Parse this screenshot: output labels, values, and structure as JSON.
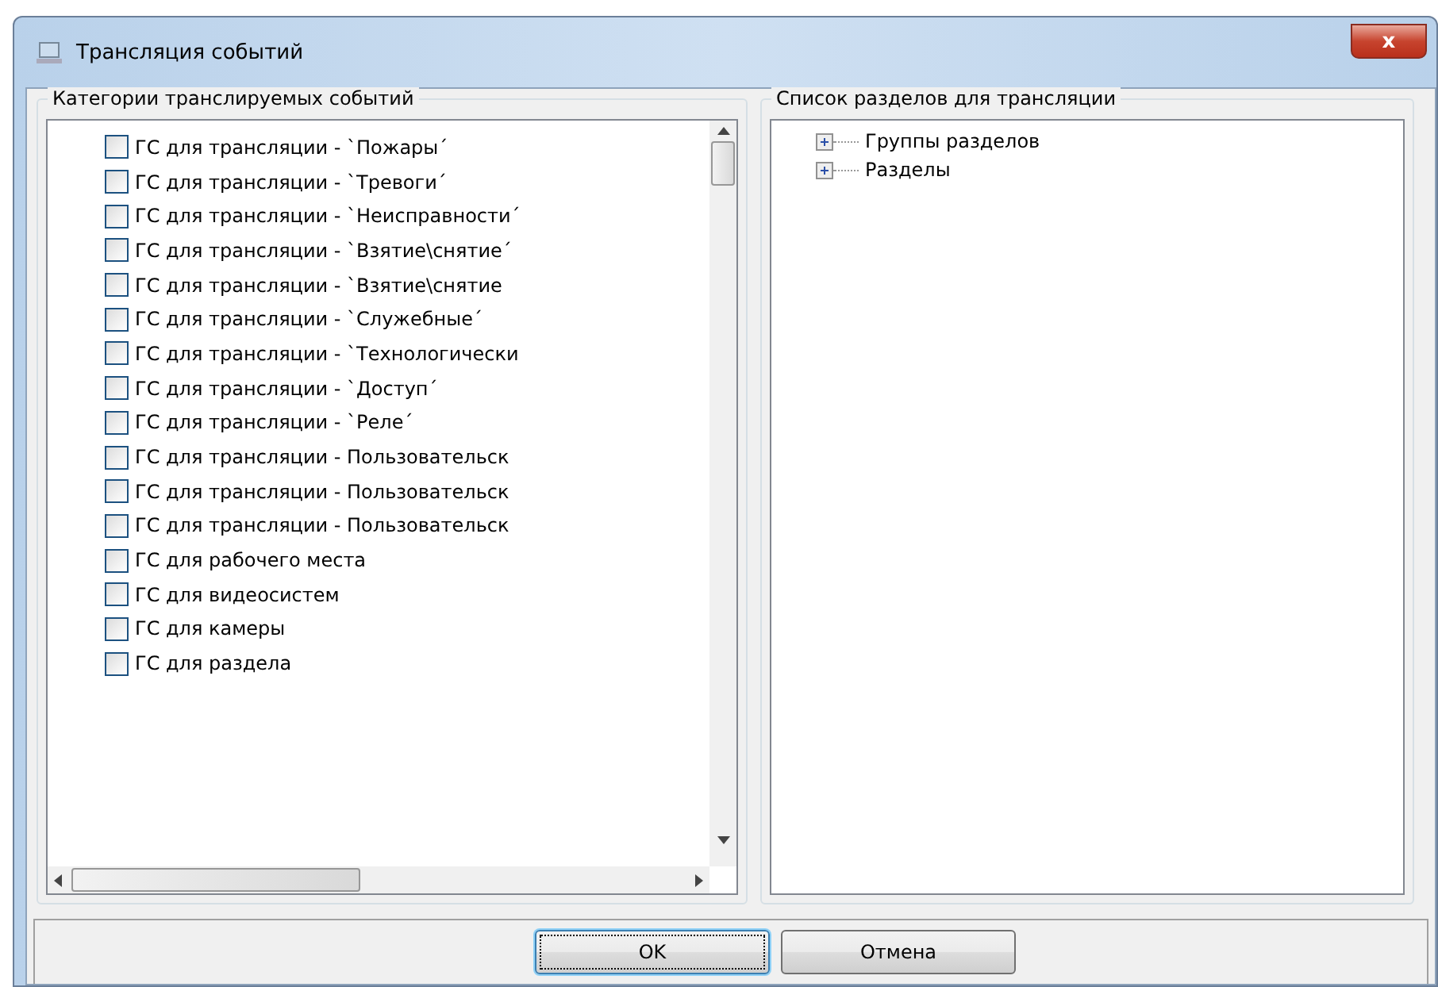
{
  "window": {
    "title": "Трансляция событий",
    "close_label": "x"
  },
  "categories": {
    "title": "Категории транслируемых событий",
    "items": [
      {
        "label": "ГС для трансляции - `Пожары´",
        "checked": false
      },
      {
        "label": "ГС для трансляции - `Тревоги´",
        "checked": false
      },
      {
        "label": "ГС для трансляции - `Неисправности´",
        "checked": false
      },
      {
        "label": "ГС для трансляции - `Взятие\\снятие´",
        "checked": false
      },
      {
        "label": "ГС для трансляции - `Взятие\\снятие",
        "checked": false
      },
      {
        "label": "ГС для трансляции - `Служебные´",
        "checked": false
      },
      {
        "label": "ГС для трансляции - `Технологически",
        "checked": false
      },
      {
        "label": "ГС для трансляции - `Доступ´",
        "checked": false
      },
      {
        "label": "ГС для трансляции - `Реле´",
        "checked": false
      },
      {
        "label": "ГС для трансляции - Пользовательск",
        "checked": false
      },
      {
        "label": "ГС для трансляции - Пользовательск",
        "checked": false
      },
      {
        "label": "ГС для трансляции - Пользовательск",
        "checked": false
      },
      {
        "label": "ГС для рабочего места",
        "checked": false
      },
      {
        "label": "ГС для видеосистем",
        "checked": false
      },
      {
        "label": "ГС для камеры",
        "checked": false
      },
      {
        "label": "ГС для раздела",
        "checked": false
      }
    ]
  },
  "sections": {
    "title": "Список разделов для трансляции",
    "items": [
      {
        "label": "Группы разделов",
        "expanded": false
      },
      {
        "label": "Разделы",
        "expanded": false
      }
    ]
  },
  "buttons": [
    {
      "label": "OK",
      "focused": true
    },
    {
      "label": "Отмена",
      "focused": false
    }
  ]
}
